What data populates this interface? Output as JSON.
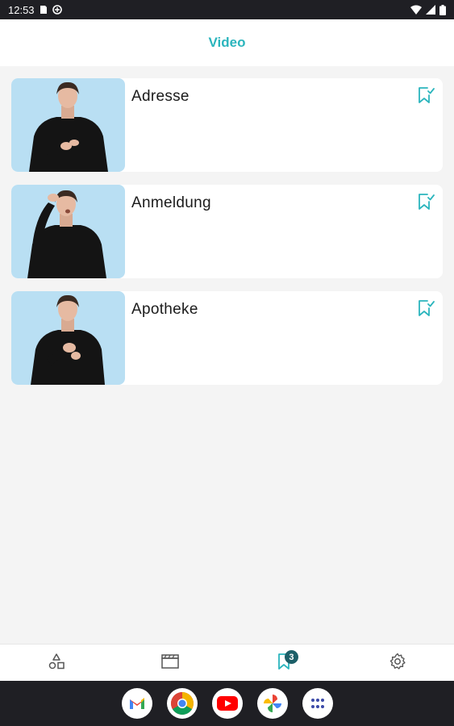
{
  "status_bar": {
    "time": "12:53",
    "icons": [
      "sim-card-icon",
      "vpn-icon",
      "wifi-icon",
      "signal-icon",
      "battery-icon"
    ]
  },
  "header": {
    "title": "Video"
  },
  "videos": [
    {
      "title": "Adresse",
      "bookmark_icon": "bookmark-check-icon"
    },
    {
      "title": "Anmeldung",
      "bookmark_icon": "bookmark-check-icon"
    },
    {
      "title": "Apotheke",
      "bookmark_icon": "bookmark-check-icon"
    }
  ],
  "bottom_nav": {
    "items": [
      {
        "icon": "shapes-icon"
      },
      {
        "icon": "clapperboard-icon"
      },
      {
        "icon": "bookmark-icon",
        "badge": "3",
        "active": true
      },
      {
        "icon": "gear-icon"
      }
    ]
  },
  "dock": {
    "apps": [
      "gmail-icon",
      "chrome-icon",
      "youtube-icon",
      "photos-icon",
      "app-drawer-icon"
    ]
  },
  "colors": {
    "accent": "#2bb5bd",
    "badge": "#1c5f68",
    "thumb_bg": "#b9dff3",
    "page_bg": "#f4f4f4",
    "system_bar": "#1f1f24"
  }
}
